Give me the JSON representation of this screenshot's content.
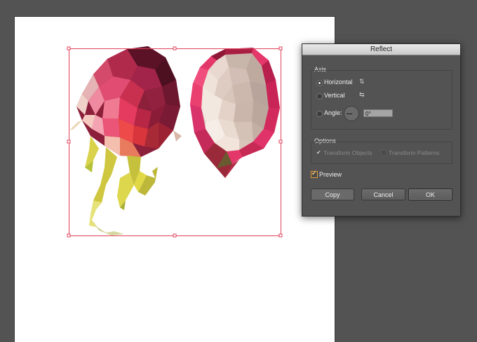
{
  "dialog": {
    "title": "Reflect",
    "axis": {
      "group_label": "Axis",
      "horizontal_label": "Horizontal",
      "vertical_label": "Vertical",
      "angle_label": "Angle:",
      "angle_value": "0°",
      "selected": "Horizontal"
    },
    "options": {
      "group_label": "Options",
      "transform_objects_label": "Transform Objects",
      "transform_patterns_label": "Transform Patterns",
      "transform_objects_checked": true,
      "transform_patterns_checked": false
    },
    "preview": {
      "label": "Preview",
      "checked": true
    },
    "buttons": {
      "copy": "Copy",
      "cancel": "Cancel",
      "ok": "OK"
    }
  },
  "colors": {
    "canvas_bg": "#535353",
    "artboard": "#ffffff",
    "selection": "#e0415a",
    "accent_preview": "#e09a3a"
  }
}
